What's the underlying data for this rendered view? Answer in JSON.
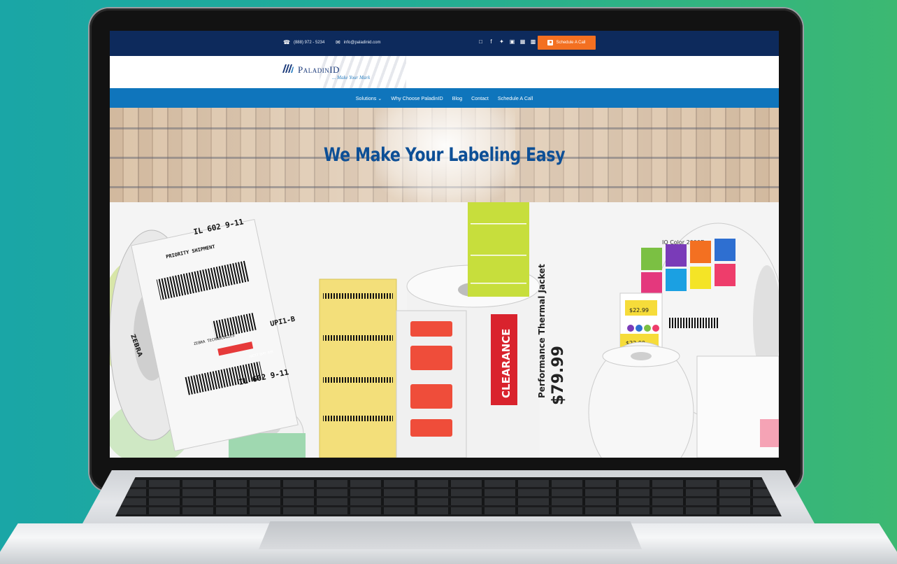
{
  "topbar": {
    "phone": "(888) 972 - 5234",
    "email": "info@paladinid.com",
    "social_icons": [
      "linkedin-icon",
      "facebook-icon",
      "twitter-icon",
      "instagram-icon",
      "google-my-business-icon",
      "rss-icon"
    ],
    "cta_label": "Schedule A Call"
  },
  "logo": {
    "name": "PaladinID",
    "tagline": "... Make Your Mark"
  },
  "nav": {
    "items": [
      "Solutions",
      "Why Choose PaladinID",
      "Blog",
      "Contact",
      "Schedule A Call"
    ]
  },
  "hero": {
    "title": "We Make Your Labeling Easy"
  },
  "products": {
    "label_left_1": "IL 602 9-11",
    "label_left_2": "PRIORITY SHIPMENT",
    "label_left_3": "UPI1-B",
    "label_left_4": "ZEBRA TECHNOLOGIES",
    "label_left_5": "NEXT DAY AIR",
    "label_left_6": "IL 602 9-11",
    "center_clearance": "CLEARANCE",
    "center_product": "Performance Thermal Jacket",
    "center_price": "$79.99",
    "right_brand": "IQ Color 2000D",
    "right_price_1": "$22.99",
    "right_price_2": "$22.99",
    "zebra": "ZEBRA"
  },
  "colors": {
    "topbar": "#0d2a5c",
    "nav": "#0f75bc",
    "cta": "#f37021",
    "hero_title": "#0d4f96"
  }
}
